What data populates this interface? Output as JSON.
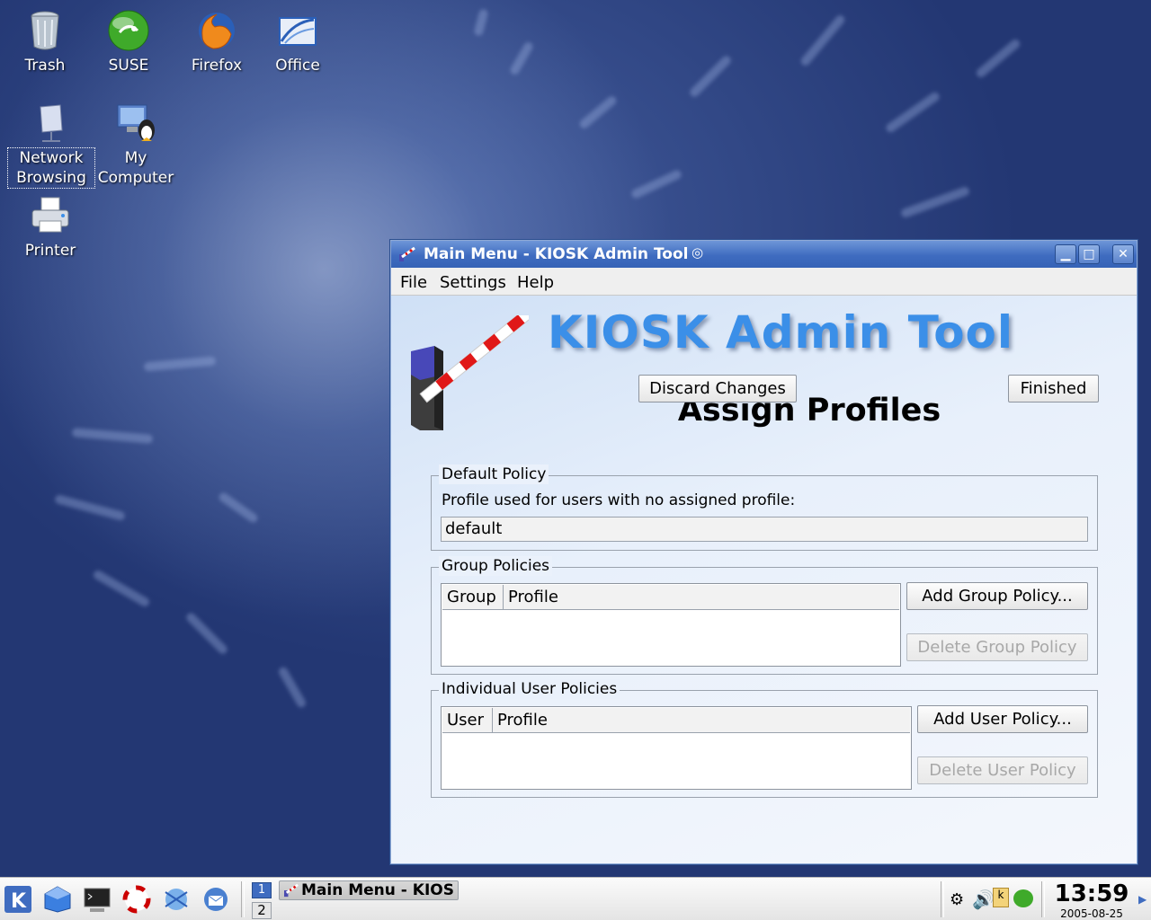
{
  "desktop": {
    "icons": [
      {
        "label": "Trash"
      },
      {
        "label": "SUSE"
      },
      {
        "label": "Firefox"
      },
      {
        "label": "Office"
      },
      {
        "label": "Network Browsing"
      },
      {
        "label": "My Computer"
      },
      {
        "label": "Printer"
      }
    ]
  },
  "window": {
    "title": "Main Menu - KIOSK Admin Tool",
    "menu": {
      "file": "File",
      "settings": "Settings",
      "help": "Help"
    },
    "banner_title": "KIOSK Admin Tool",
    "page_heading": "Assign Profiles",
    "default_policy": {
      "legend": "Default Policy",
      "label": "Profile used for users with no assigned profile:",
      "value": "default"
    },
    "group_policies": {
      "legend": "Group Policies",
      "columns": [
        "Group",
        "Profile"
      ],
      "add_button": "Add Group Policy...",
      "delete_button": "Delete Group Policy"
    },
    "user_policies": {
      "legend": "Individual User Policies",
      "columns": [
        "User",
        "Profile"
      ],
      "add_button": "Add User Policy...",
      "delete_button": "Delete User Policy"
    },
    "discard_button": "Discard Changes",
    "finished_button": "Finished"
  },
  "taskbar": {
    "task_label": "Main Menu - KIOS",
    "pager": [
      "1",
      "2"
    ],
    "clock": "13:59",
    "date": "2005-08-25"
  },
  "colors": {
    "banner_blue": "#3b8fe8",
    "titlebar_blue": "#3f6cc0",
    "desktop_blue": "#223a74"
  }
}
